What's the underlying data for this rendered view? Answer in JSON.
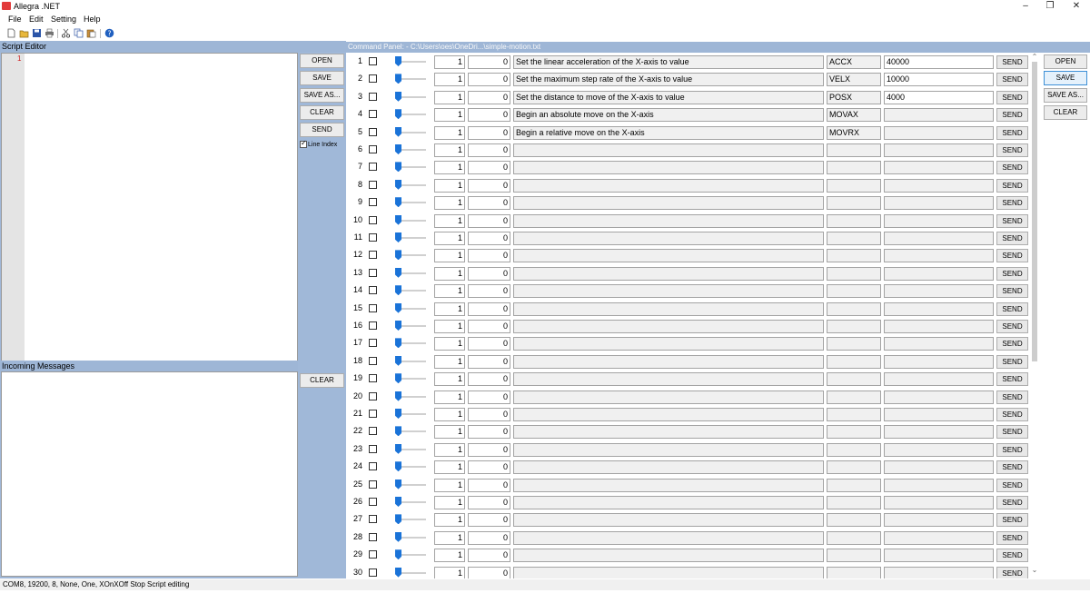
{
  "window": {
    "title": "Allegra .NET",
    "minimize": "–",
    "maximize": "❐",
    "close": "✕"
  },
  "menu": [
    "File",
    "Edit",
    "Setting",
    "Help"
  ],
  "toolbar_icons": [
    "new-file-icon",
    "open-folder-icon",
    "save-icon",
    "print-icon",
    "cut-icon",
    "copy-icon",
    "paste-icon",
    "help-icon"
  ],
  "script_editor": {
    "title": "Script Editor",
    "line_number": "1",
    "buttons": [
      "OPEN",
      "SAVE",
      "SAVE AS...",
      "CLEAR",
      "SEND"
    ],
    "line_index_label": "Line Index",
    "line_index_checked": true
  },
  "incoming": {
    "title": "Incoming Messages",
    "clear_label": "CLEAR"
  },
  "command_panel": {
    "title": "Command Panel:  - C:\\Users\\oes\\OneDri...\\simple-motion.txt",
    "send_label": "SEND",
    "rows": [
      {
        "n": "1",
        "a": "1",
        "b": "0",
        "desc": "Set the linear acceleration of the X-axis to value",
        "cmd": "ACCX",
        "val": "40000",
        "editable": true
      },
      {
        "n": "2",
        "a": "1",
        "b": "0",
        "desc": "Set the maximum step rate of the X-axis to value",
        "cmd": "VELX",
        "val": "10000",
        "editable": true
      },
      {
        "n": "3",
        "a": "1",
        "b": "0",
        "desc": "Set the distance to move of the X-axis to value",
        "cmd": "POSX",
        "val": "4000",
        "editable": true
      },
      {
        "n": "4",
        "a": "1",
        "b": "0",
        "desc": "Begin an absolute move on the X-axis",
        "cmd": "MOVAX",
        "val": "",
        "editable": false
      },
      {
        "n": "5",
        "a": "1",
        "b": "0",
        "desc": "Begin a relative move on the X-axis",
        "cmd": "MOVRX",
        "val": "",
        "editable": false
      },
      {
        "n": "6",
        "a": "1",
        "b": "0",
        "desc": "",
        "cmd": "",
        "val": "",
        "editable": false
      },
      {
        "n": "7",
        "a": "1",
        "b": "0",
        "desc": "",
        "cmd": "",
        "val": "",
        "editable": false
      },
      {
        "n": "8",
        "a": "1",
        "b": "0",
        "desc": "",
        "cmd": "",
        "val": "",
        "editable": false
      },
      {
        "n": "9",
        "a": "1",
        "b": "0",
        "desc": "",
        "cmd": "",
        "val": "",
        "editable": false
      },
      {
        "n": "10",
        "a": "1",
        "b": "0",
        "desc": "",
        "cmd": "",
        "val": "",
        "editable": false
      },
      {
        "n": "11",
        "a": "1",
        "b": "0",
        "desc": "",
        "cmd": "",
        "val": "",
        "editable": false
      },
      {
        "n": "12",
        "a": "1",
        "b": "0",
        "desc": "",
        "cmd": "",
        "val": "",
        "editable": false
      },
      {
        "n": "13",
        "a": "1",
        "b": "0",
        "desc": "",
        "cmd": "",
        "val": "",
        "editable": false
      },
      {
        "n": "14",
        "a": "1",
        "b": "0",
        "desc": "",
        "cmd": "",
        "val": "",
        "editable": false
      },
      {
        "n": "15",
        "a": "1",
        "b": "0",
        "desc": "",
        "cmd": "",
        "val": "",
        "editable": false
      },
      {
        "n": "16",
        "a": "1",
        "b": "0",
        "desc": "",
        "cmd": "",
        "val": "",
        "editable": false
      },
      {
        "n": "17",
        "a": "1",
        "b": "0",
        "desc": "",
        "cmd": "",
        "val": "",
        "editable": false
      },
      {
        "n": "18",
        "a": "1",
        "b": "0",
        "desc": "",
        "cmd": "",
        "val": "",
        "editable": false
      },
      {
        "n": "19",
        "a": "1",
        "b": "0",
        "desc": "",
        "cmd": "",
        "val": "",
        "editable": false
      },
      {
        "n": "20",
        "a": "1",
        "b": "0",
        "desc": "",
        "cmd": "",
        "val": "",
        "editable": false
      },
      {
        "n": "21",
        "a": "1",
        "b": "0",
        "desc": "",
        "cmd": "",
        "val": "",
        "editable": false
      },
      {
        "n": "22",
        "a": "1",
        "b": "0",
        "desc": "",
        "cmd": "",
        "val": "",
        "editable": false
      },
      {
        "n": "23",
        "a": "1",
        "b": "0",
        "desc": "",
        "cmd": "",
        "val": "",
        "editable": false
      },
      {
        "n": "24",
        "a": "1",
        "b": "0",
        "desc": "",
        "cmd": "",
        "val": "",
        "editable": false
      },
      {
        "n": "25",
        "a": "1",
        "b": "0",
        "desc": "",
        "cmd": "",
        "val": "",
        "editable": false
      },
      {
        "n": "26",
        "a": "1",
        "b": "0",
        "desc": "",
        "cmd": "",
        "val": "",
        "editable": false
      },
      {
        "n": "27",
        "a": "1",
        "b": "0",
        "desc": "",
        "cmd": "",
        "val": "",
        "editable": false
      },
      {
        "n": "28",
        "a": "1",
        "b": "0",
        "desc": "",
        "cmd": "",
        "val": "",
        "editable": false
      },
      {
        "n": "29",
        "a": "1",
        "b": "0",
        "desc": "",
        "cmd": "",
        "val": "",
        "editable": false
      },
      {
        "n": "30",
        "a": "1",
        "b": "0",
        "desc": "",
        "cmd": "",
        "val": "",
        "editable": false
      }
    ]
  },
  "right_buttons": [
    "OPEN",
    "SAVE",
    "SAVE AS...",
    "CLEAR"
  ],
  "status": "COM8, 19200, 8, None, One, XOnXOff  Stop  Script editing",
  "colors": {
    "panel_bg": "#a0b8d8",
    "slider_thumb": "#1a73d8",
    "accent_border": "#3c8fd6"
  }
}
